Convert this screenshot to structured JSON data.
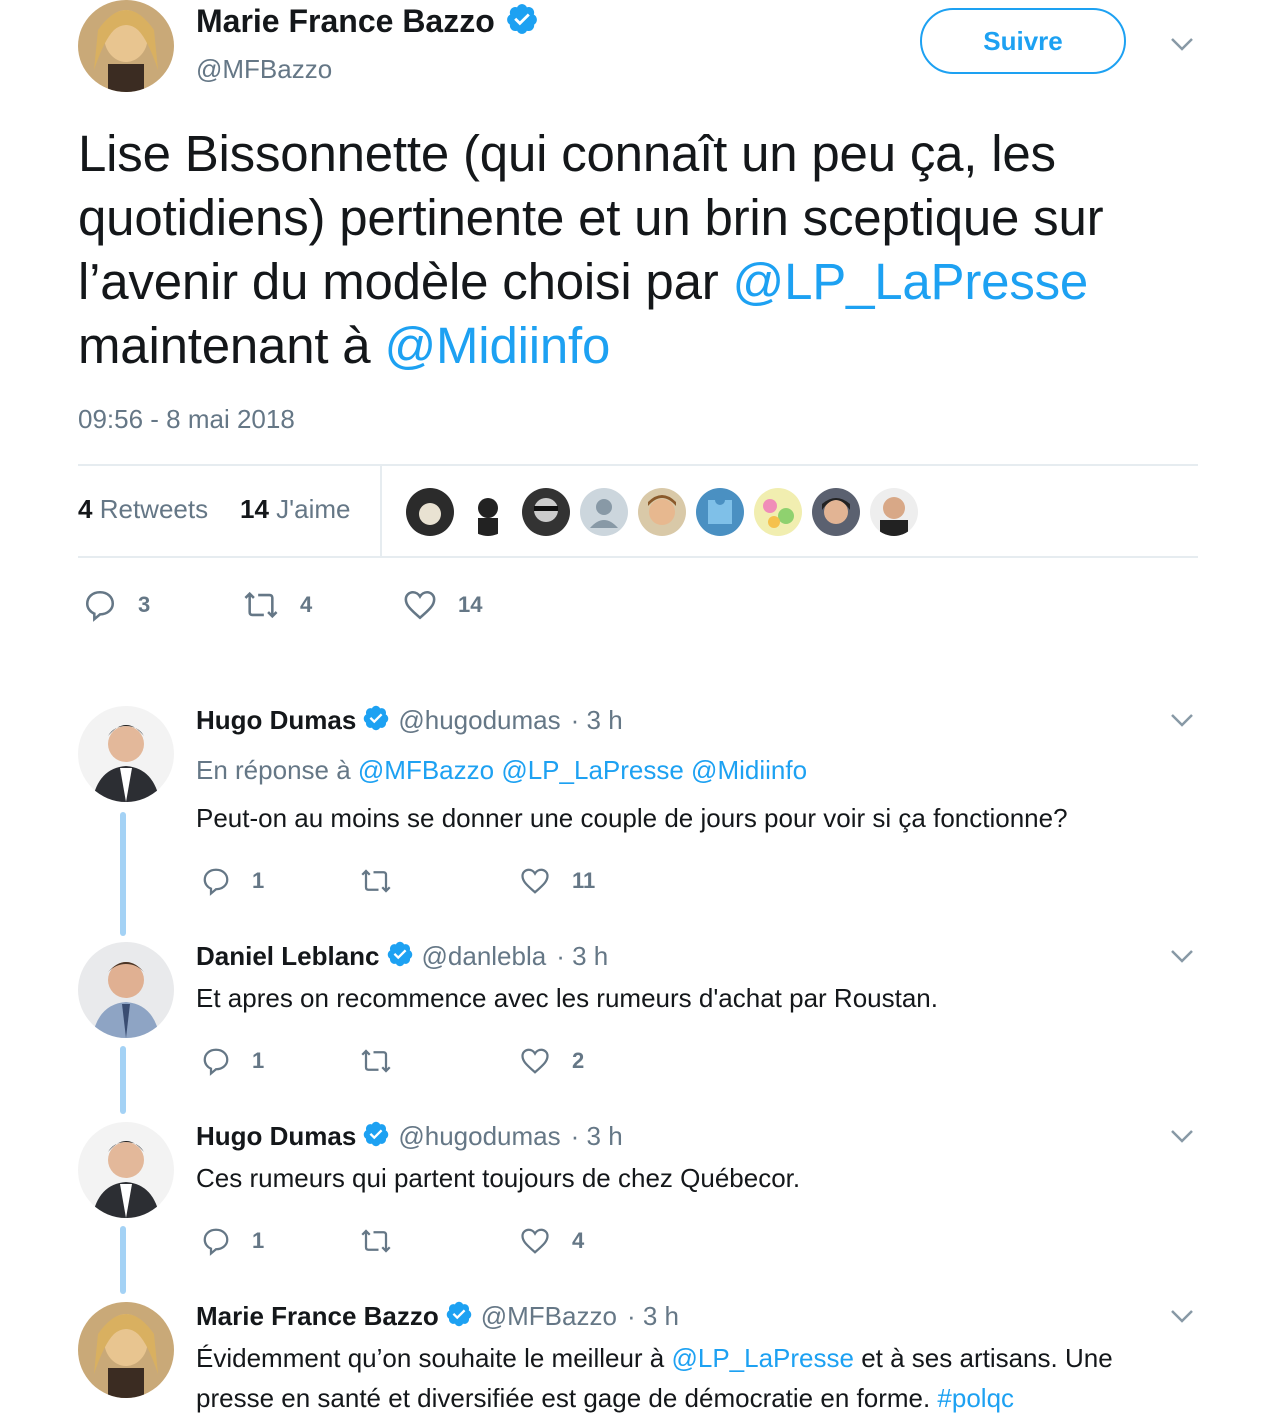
{
  "tweet": {
    "author_name": "Marie France Bazzo",
    "author_handle": "@MFBazzo",
    "follow_label": "Suivre",
    "text_part1": "Lise Bissonnette (qui connaît un peu ça, les quotidiens) pertinente et un brin sceptique sur l’avenir du modèle choisi par ",
    "mention1": "@LP_LaPresse",
    "text_part2": " maintenant à ",
    "mention2": "@Midiinfo",
    "timestamp": "09:56 - 8 mai 2018",
    "retweets_count": "4",
    "retweets_label": "Retweets",
    "likes_count": "14",
    "likes_label": "J'aime",
    "reply_count": "3",
    "retweet_count": "4",
    "like_count": "14"
  },
  "replies": [
    {
      "name": "Hugo Dumas",
      "handle": "@hugodumas",
      "time": "· 3 h",
      "reply_prefix": "En réponse à",
      "reply_mentions": "@MFBazzo @LP_LaPresse @Midiinfo",
      "text": "Peut-on au moins se donner une couple de jours pour voir si ça fonctionne?",
      "reply_count": "1",
      "like_count": "11"
    },
    {
      "name": "Daniel Leblanc",
      "handle": "@danlebla",
      "time": "· 3 h",
      "text": "Et apres on recommence avec les rumeurs d'achat par Roustan.",
      "reply_count": "1",
      "like_count": "2"
    },
    {
      "name": "Hugo Dumas",
      "handle": "@hugodumas",
      "time": "· 3 h",
      "text": "Ces rumeurs qui partent toujours de chez Québecor.",
      "reply_count": "1",
      "like_count": "4"
    },
    {
      "name": "Marie France Bazzo",
      "handle": "@MFBazzo",
      "time": "· 3 h",
      "text_a": "Évidemment qu’on souhaite le meilleur à ",
      "mention": "@LP_LaPresse",
      "text_b": " et à ses artisans. Une presse en santé et diversifiée est gage de démocratie en forme. ",
      "hashtag": "#polqc"
    }
  ],
  "colors": {
    "accent": "#1da1f2",
    "secondary_text": "#657786",
    "thread_line": "#a4d2f5",
    "divider": "#e6ecf0"
  },
  "icons": [
    "verified-badge-icon",
    "chevron-down-icon",
    "reply-icon",
    "retweet-icon",
    "heart-icon"
  ]
}
